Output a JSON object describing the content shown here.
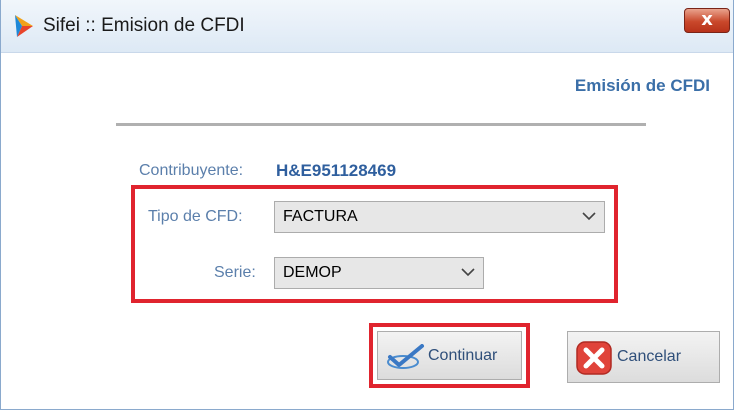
{
  "window": {
    "title": "Sifei :: Emision de CFDI",
    "close_glyph": "x"
  },
  "form": {
    "heading": "Emisión de CFDI",
    "contribuyente": {
      "label": "Contribuyente:",
      "value": "H&E951128469"
    },
    "tipo_cfd": {
      "label": "Tipo de CFD:",
      "selected": "FACTURA"
    },
    "serie": {
      "label": "Serie:",
      "selected": "DEMOP"
    }
  },
  "buttons": {
    "continuar": {
      "label": "Continuar",
      "icon": "checkmark-icon"
    },
    "cancelar": {
      "label": "Cancelar",
      "icon": "cancel-x-icon"
    }
  },
  "colors": {
    "highlight": "#e0242e",
    "label_blue": "#5b7fab",
    "value_blue": "#2f5f9e"
  }
}
